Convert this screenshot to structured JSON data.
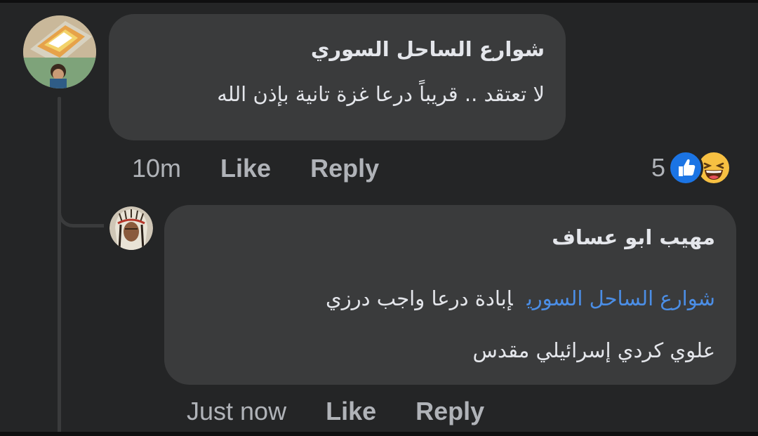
{
  "colors": {
    "background": "#242526",
    "bubble": "#3a3b3c",
    "primary_text": "#e4e6eb",
    "secondary_text": "#b0b3b8",
    "mention": "#4b8ee6",
    "like_reaction": "#1b74e4",
    "haha_reaction": "#f7c042"
  },
  "comments": [
    {
      "author": "شوارع الساحل السوري",
      "text": "لا تعتقد .. قريباً درعا غزة تانية بإذن الله",
      "time": "10m",
      "like_label": "Like",
      "reply_label": "Reply",
      "reaction_count": "5",
      "reaction_icons": [
        "like-icon",
        "haha-icon"
      ]
    },
    {
      "author": "مهيب ابو عساف",
      "mention": "شوارع الساحل السوري",
      "text_line1": "إبادة درعا واجب درزي",
      "text_line2": "علوي كردي إسرائيلي مقدس",
      "time": "Just now",
      "like_label": "Like",
      "reply_label": "Reply"
    }
  ]
}
